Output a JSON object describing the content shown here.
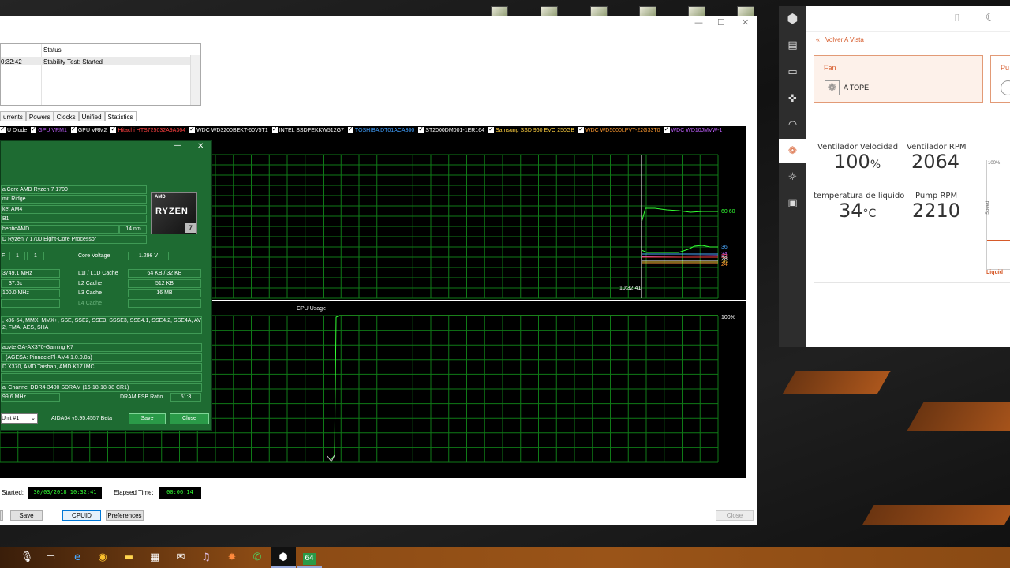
{
  "aida": {
    "status_header": "Status",
    "status_time": "0:32:42",
    "status_text": "Stability Test: Started",
    "tabs": [
      "urrents",
      "Powers",
      "Clocks",
      "Unified",
      "Statistics"
    ],
    "legend": [
      {
        "label": "U Diode",
        "color": "#ffffff"
      },
      {
        "label": "GPU VRM1",
        "color": "#c060ff"
      },
      {
        "label": "GPU VRM2",
        "color": "#ffffff"
      },
      {
        "label": "Hitachi HTS725032A9A364",
        "color": "#ff4040"
      },
      {
        "label": "WDC WD3200BEKT-60V5T1",
        "color": "#ffffff"
      },
      {
        "label": "INTEL SSDPEKKW512G7",
        "color": "#ffffff"
      },
      {
        "label": "TOSHIBA DT01ACA300",
        "color": "#40a0ff"
      },
      {
        "label": "ST2000DM001-1ER164",
        "color": "#ffffff"
      },
      {
        "label": "Samsung SSD 960 EVO 250GB",
        "color": "#ffd040"
      },
      {
        "label": "WDC WD5000LPVT-22G33T0",
        "color": "#ff9a30"
      },
      {
        "label": "WDC WD10JMVW-1",
        "color": "#c060ff"
      }
    ],
    "graph1_time": "10:32:41",
    "graph1_values": [
      {
        "label": "60 60",
        "color": "#33ff33"
      },
      {
        "label": "36",
        "color": "#4aa8ff"
      },
      {
        "label": "34",
        "color": "#c060ff"
      },
      {
        "label": "32",
        "color": "#ff4040"
      },
      {
        "label": "28",
        "color": "#ffffff"
      },
      {
        "label": "26",
        "color": "#ffd040"
      },
      {
        "label": "24",
        "color": "#ff9a30"
      }
    ],
    "graph2_title": "CPU Usage",
    "graph2_scale": "100%",
    "started_label": "Started:",
    "started_value": "30/03/2018 10:32:41",
    "elapsed_label": "Elapsed Time:",
    "elapsed_value": "00:06:14",
    "buttons": {
      "save": "Save",
      "cpuid": "CPUID",
      "preferences": "Preferences",
      "close": "Close"
    }
  },
  "cpuid": {
    "close_glyph": "✕",
    "min_glyph": "—",
    "name": "alCore AMD Ryzen 7 1700",
    "codename": "mit Ridge",
    "socket": "ket AM4",
    "stepping": "B1",
    "vendor": "henticAMD",
    "process": "14 nm",
    "brand": "D Ryzen 7 1700 Eight-Core Processor",
    "logo_brand": "AMD",
    "logo_text": "RYZEN",
    "logo_num": "7",
    "f_label": "F",
    "f_vals": [
      "1",
      "1"
    ],
    "core_voltage_label": "Core Voltage",
    "core_voltage": "1.296 V",
    "clock": "3749.1 MHz",
    "multiplier": "37.5x",
    "bus": "100.0 MHz",
    "l1_label": "L1I / L1D Cache",
    "l1": "64 KB / 32 KB",
    "l2_label": "L2 Cache",
    "l2": "512 KB",
    "l3_label": "L3 Cache",
    "l3": "16 MB",
    "l4_label": "L4 Cache",
    "instructions_1": ", x86-64, MMX, MMX+, SSE, SSE2, SSE3, SSSE3, SSE4.1, SSE4.2, SSE4A, AVX,",
    "instructions_2": "2, FMA, AES, SHA",
    "mobo": "abyte GA-AX370-Gaming K7",
    "bios": "(AGESA: PinnaclePl-AM4 1.0.0.0a)",
    "chipset": "D X370, AMD Taishan, AMD K17 IMC",
    "memory": "al Channel DDR4-3400 SDRAM  (16-18-18-38 CR1)",
    "mem_clock": "99.6 MHz",
    "ratio_label": "DRAM:FSB Ratio",
    "ratio": "51:3",
    "unit_select": "Unit #1",
    "version": "AIDA64 v5.95.4557 Beta",
    "save": "Save",
    "close": "Close"
  },
  "giga": {
    "back": "Volver A Vista",
    "card1_title": "Fan",
    "card1_value": "A TOPE",
    "card2_title": "Pu",
    "stats": [
      {
        "label": "Ventilador Velocidad",
        "value": "100",
        "unit": "%"
      },
      {
        "label": "Ventilador RPM",
        "value": "2064",
        "unit": ""
      },
      {
        "label": "temperatura de liquido",
        "value": "34",
        "unit": "°C"
      },
      {
        "label": "Pump RPM",
        "value": "2210",
        "unit": ""
      }
    ],
    "chart_top": "100%",
    "chart_axis": "Speed",
    "chart_label": "Liquid"
  },
  "taskbar": {
    "items": [
      "mic-icon",
      "task-view-icon",
      "edge-icon",
      "chrome-icon",
      "explorer-icon",
      "store-icon",
      "mail-icon",
      "itunes-icon",
      "app-icon",
      "whatsapp-icon",
      "gigabyte-app-icon",
      "aida64-icon"
    ],
    "aida_label": "64"
  }
}
